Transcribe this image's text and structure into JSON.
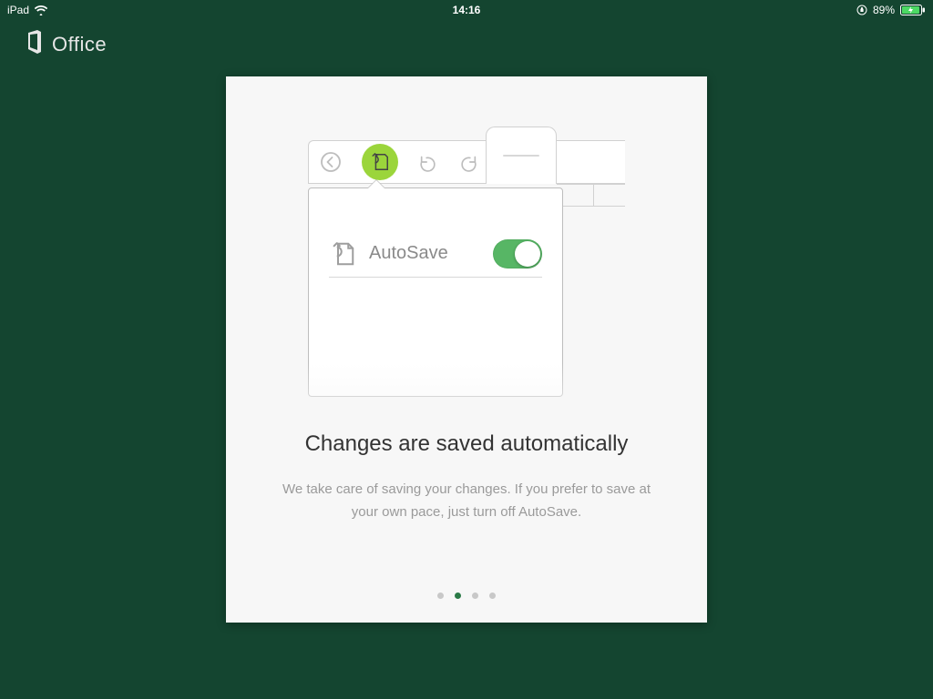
{
  "status": {
    "device": "iPad",
    "time": "14:16",
    "battery_pct": "89%"
  },
  "brand": {
    "name": "Office"
  },
  "illustration": {
    "popover_label": "AutoSave"
  },
  "onboarding": {
    "headline": "Changes are saved automatically",
    "body": "We take care of saving your changes. If you prefer to save at your own pace, just turn off AutoSave.",
    "page_count": 4,
    "active_page_index": 1
  },
  "colors": {
    "background": "#144530",
    "accent_green": "#57b665",
    "halo_green": "#9bd53b",
    "dot_active": "#2b7a47"
  }
}
